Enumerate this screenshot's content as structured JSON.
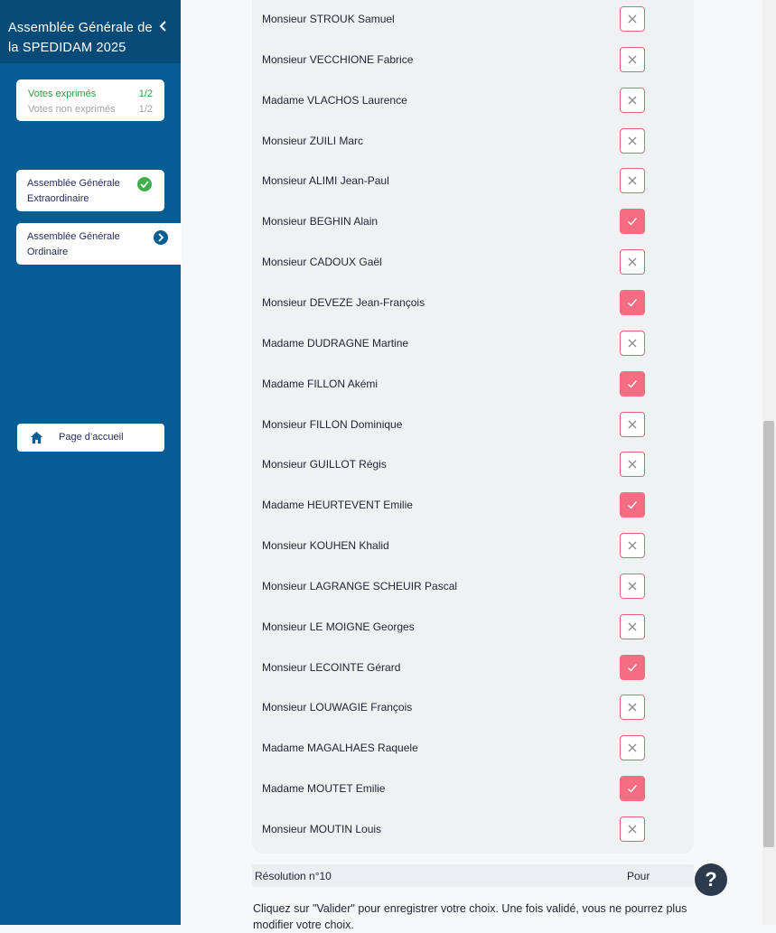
{
  "sidebar": {
    "title": "Assemblée Générale de la SPEDIDAM 2025",
    "collapse_icon": "chevron-left-icon",
    "votes": {
      "expressed_label": "Votes exprimés",
      "expressed_count": "1/2",
      "not_expressed_label": "Votes non exprimés",
      "not_expressed_count": "1/2"
    },
    "nav": [
      {
        "label": "Assemblée Générale Extraordinaire",
        "status_icon": "check-circle-icon"
      },
      {
        "label": "Assemblée Générale Ordinaire",
        "status_icon": "chevron-right-circle-icon"
      }
    ],
    "home_label": "Page d’accueil",
    "home_icon": "home-icon"
  },
  "members": [
    {
      "name": "Monsieur STROUK Samuel",
      "vote": "no"
    },
    {
      "name": "Monsieur VECCHIONE Fabrice",
      "vote": "no"
    },
    {
      "name": "Madame VLACHOS Laurence",
      "vote": "no"
    },
    {
      "name": "Monsieur ZUILI Marc",
      "vote": "no"
    },
    {
      "name": "Monsieur ALIMI Jean-Paul",
      "vote": "no"
    },
    {
      "name": "Monsieur BEGHIN Alain",
      "vote": "yes"
    },
    {
      "name": "Monsieur CADOUX Gaël",
      "vote": "no"
    },
    {
      "name": "Monsieur DEVEZE Jean-François",
      "vote": "yes"
    },
    {
      "name": "Madame DUDRAGNE Martine",
      "vote": "no"
    },
    {
      "name": "Madame FILLON Akémi",
      "vote": "yes"
    },
    {
      "name": "Monsieur FILLON Dominique",
      "vote": "no"
    },
    {
      "name": "Monsieur GUILLOT Régis",
      "vote": "no"
    },
    {
      "name": "Madame HEURTEVENT Emilie",
      "vote": "yes"
    },
    {
      "name": "Monsieur KOUHEN Khalid",
      "vote": "no"
    },
    {
      "name": "Monsieur LAGRANGE SCHEUIR Pascal",
      "vote": "no"
    },
    {
      "name": "Monsieur LE MOIGNE Georges",
      "vote": "no"
    },
    {
      "name": "Monsieur LECOINTE Gérard",
      "vote": "yes"
    },
    {
      "name": "Monsieur LOUWAGIE François",
      "vote": "no"
    },
    {
      "name": "Madame MAGALHAES Raquele",
      "vote": "no"
    },
    {
      "name": "Madame MOUTET Emilie",
      "vote": "yes"
    },
    {
      "name": "Monsieur MOUTIN Louis",
      "vote": "no"
    }
  ],
  "resolution": {
    "label": "Résolution n°10",
    "value": "Pour"
  },
  "help_label": "?",
  "instructions": "Cliquez sur \"Valider\" pour enregistrer votre choix. Une fois validé, vous ne pourrez plus modifier votre choix.",
  "colors": {
    "sidebar": "#065d93",
    "sidebar_header": "#064a77",
    "check_selected": "#f46d80",
    "check_border": "#e4647a",
    "expressed_green": "#2e9e3e"
  }
}
